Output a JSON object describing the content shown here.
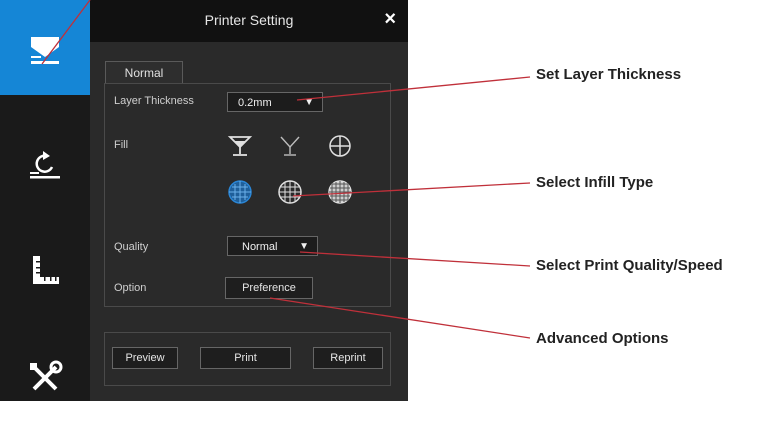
{
  "dialog": {
    "title": "Printer Setting",
    "close_label": "×"
  },
  "sidebar": {
    "items": [
      {
        "icon": "print-icon",
        "active": true
      },
      {
        "icon": "rotate-icon",
        "active": false
      },
      {
        "icon": "scale-ruler-icon",
        "active": false
      },
      {
        "icon": "tools-icon",
        "active": false
      }
    ]
  },
  "tab": {
    "label": "Normal"
  },
  "layer_thickness": {
    "label": "Layer Thickness",
    "value": "0.2mm",
    "arrow": "▼"
  },
  "fill": {
    "label": "Fill",
    "options": [
      "solid-cup-icon",
      "hollow-cup-icon",
      "circle-cross-icon",
      "fill-grid-sparse-icon",
      "fill-grid-medium-icon",
      "fill-grid-dense-icon"
    ],
    "selected_index": 3
  },
  "quality": {
    "label": "Quality",
    "value": "Normal",
    "arrow": "▼"
  },
  "option": {
    "label": "Option",
    "button": "Preference"
  },
  "actions": {
    "preview": "Preview",
    "print": "Print",
    "reprint": "Reprint"
  },
  "callouts": {
    "layer": "Set Layer Thickness",
    "infill": "Select Infill Type",
    "quality": "Select Print Quality/Speed",
    "advanced": "Advanced Options"
  },
  "colors": {
    "accent": "#1586d6",
    "callout_line": "#c0303a",
    "panel": "#2a2a2a",
    "sidebar": "#1a1a1a"
  }
}
